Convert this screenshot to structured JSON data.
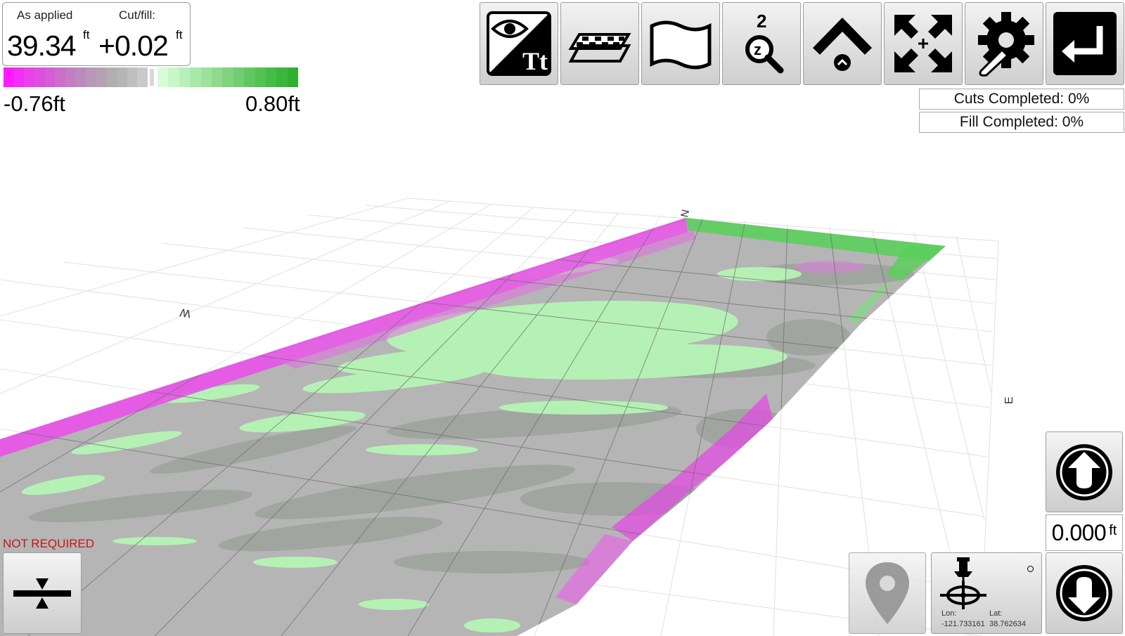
{
  "readout": {
    "as_applied_label": "As applied",
    "cut_fill_label": "Cut/fill:",
    "as_applied_value": "39.34",
    "cut_fill_value": "+0.02",
    "as_applied_unit": "ft",
    "cut_fill_unit": "ft"
  },
  "legend": {
    "min": "-0.76ft",
    "max": "0.80ft",
    "cut_color": "#ff22ff",
    "fill_color": "#2fb52f"
  },
  "toolbar": {
    "buttons": [
      {
        "icon": "view-text-icon"
      },
      {
        "icon": "layers-icon"
      },
      {
        "icon": "map-icon"
      },
      {
        "icon": "zoom-level-icon",
        "label": "2"
      },
      {
        "icon": "raise-view-icon"
      },
      {
        "icon": "fit-extents-icon"
      },
      {
        "icon": "settings-icon"
      },
      {
        "icon": "exit-icon"
      }
    ]
  },
  "status": {
    "cuts": "Cuts Completed: 0%",
    "fill": "Fill Completed: 0%"
  },
  "compass": {
    "north": "N",
    "west": "W",
    "east": "E"
  },
  "blade": {
    "not_required": "NOT REQUIRED",
    "offset_value": "0.000",
    "offset_unit": "ft"
  },
  "position": {
    "lon_label": "Lon:",
    "lat_label": "Lat:",
    "lon": "-121.733161",
    "lat": "38.762634"
  }
}
